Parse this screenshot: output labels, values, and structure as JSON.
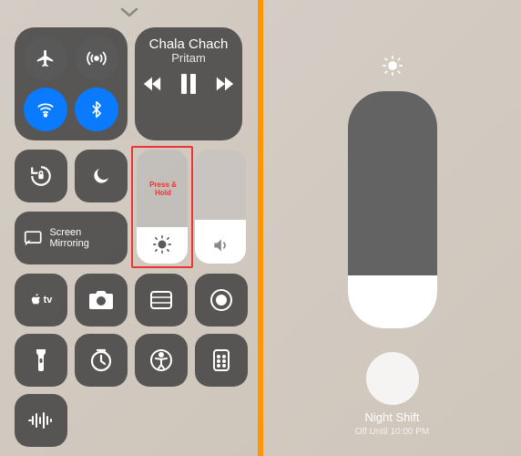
{
  "music": {
    "title": "Chala Chach",
    "artist": "Pritam"
  },
  "mirror": {
    "label": "Screen Mirroring"
  },
  "atv_label": "tv",
  "highlight_label": "Press & Hold",
  "night_shift": {
    "title": "Night Shift",
    "subtitle": "Off Until 10:00 PM"
  }
}
